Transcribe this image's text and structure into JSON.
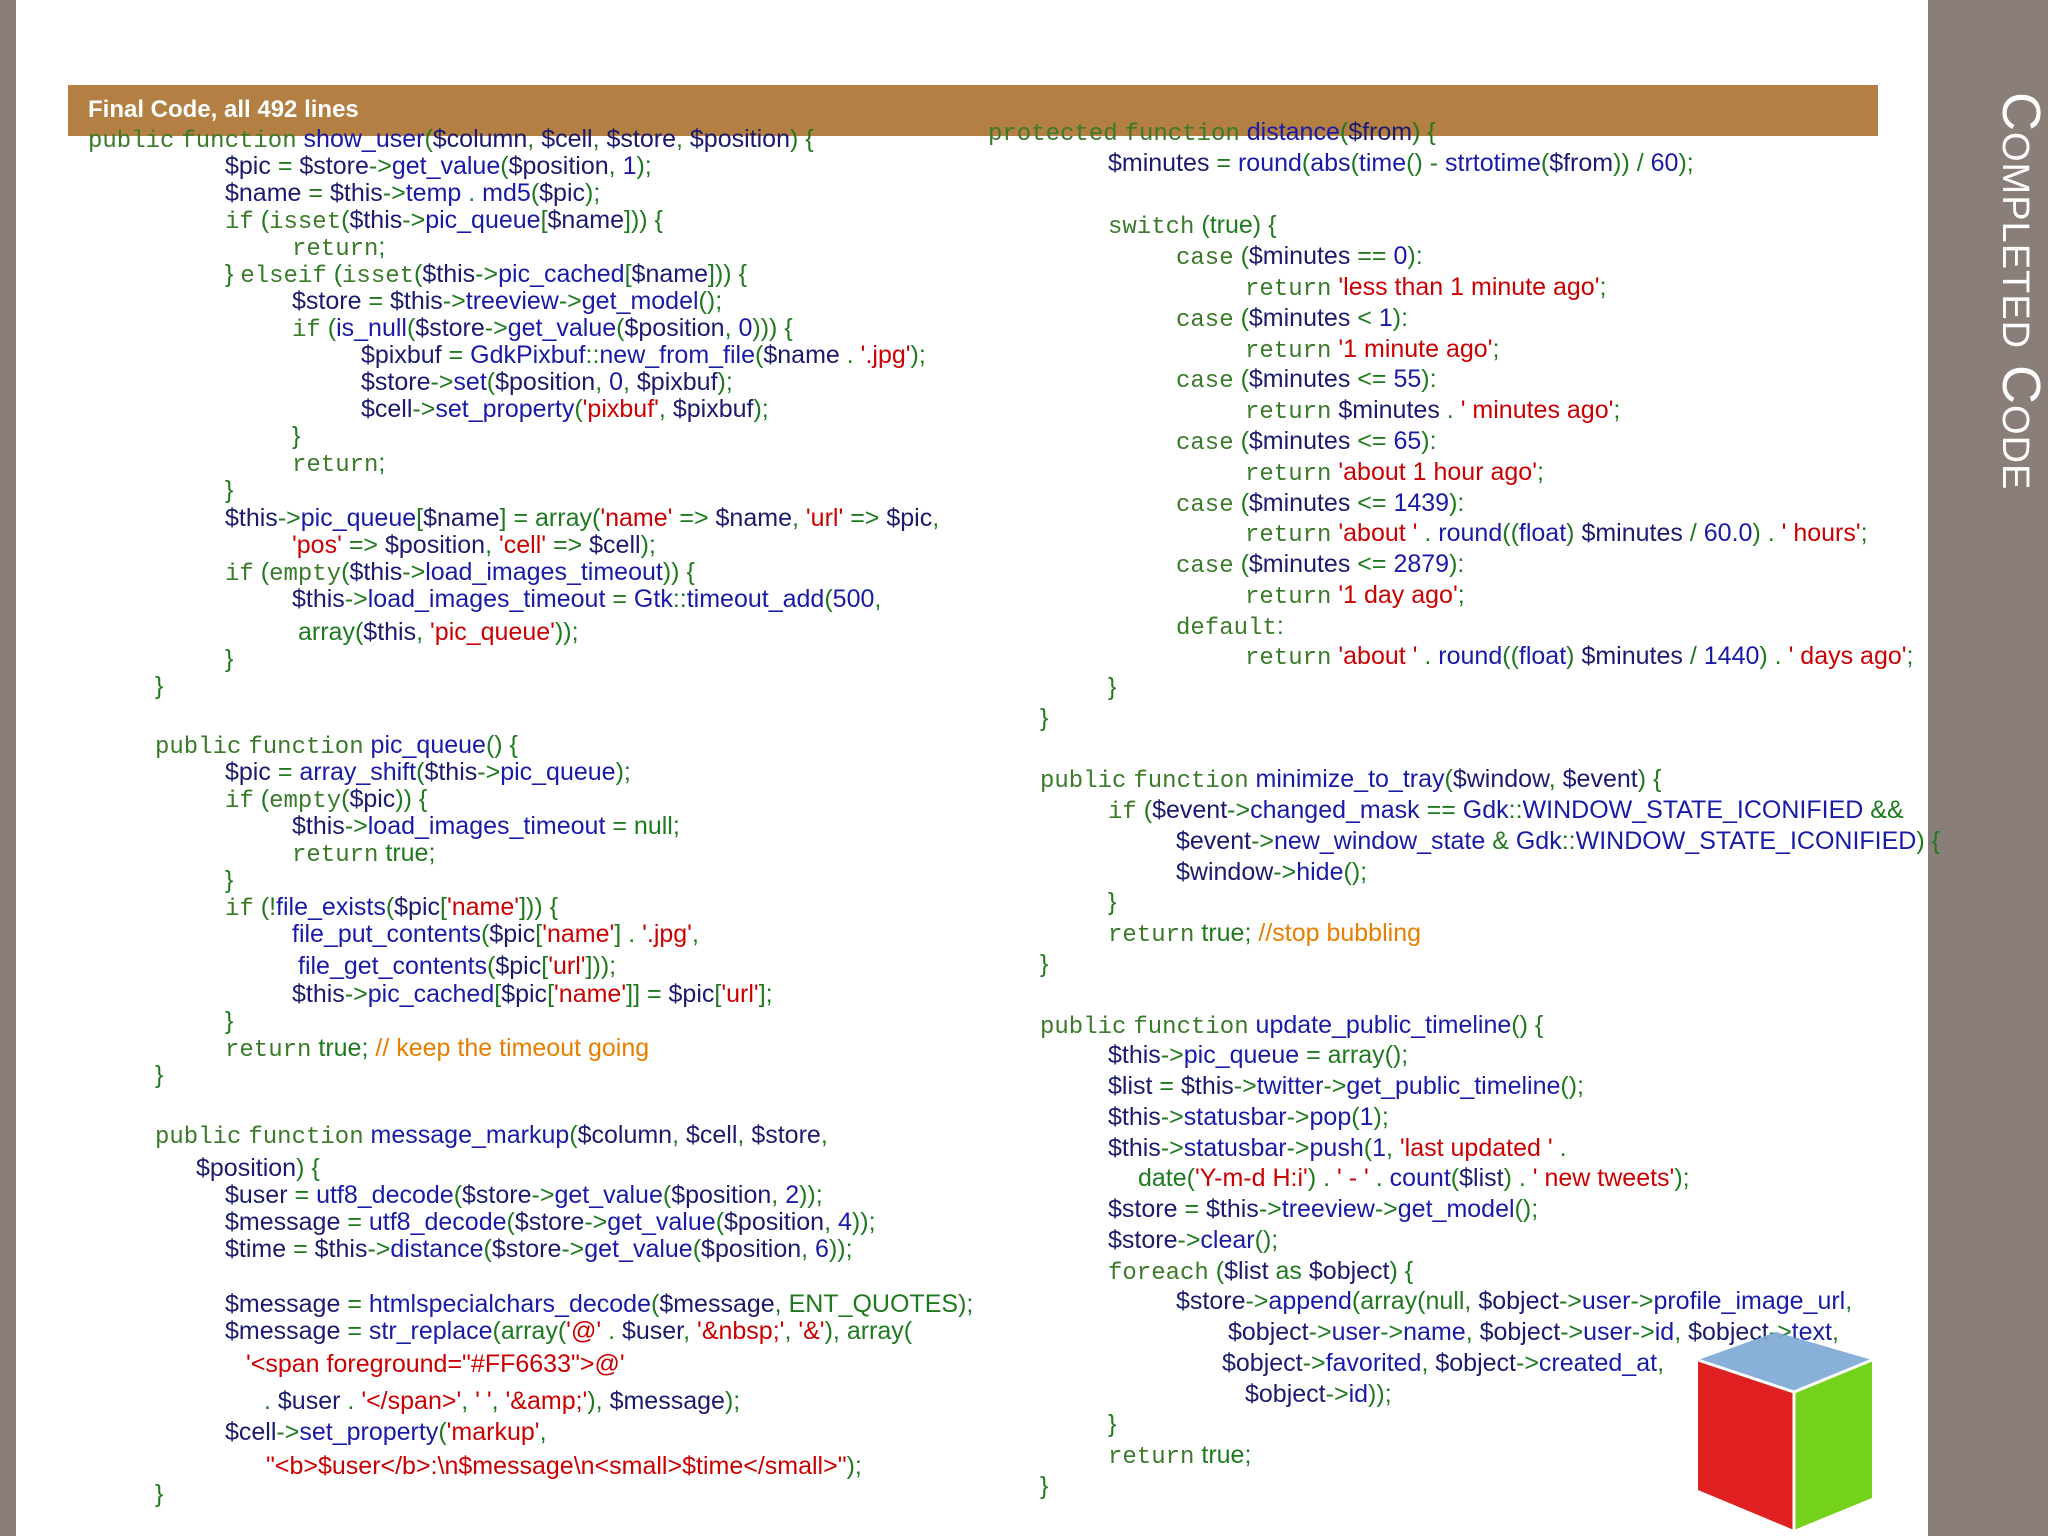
{
  "slide": {
    "header": "Final Code, all 492 lines",
    "title": "Completed Code"
  },
  "code": {
    "left": [
      "public function show_user($column, $cell, $store, $position) {",
      "$pic = $store->get_value($position, 1);",
      "$name = $this->temp . md5($pic);",
      "if (isset($this->pic_queue[$name])) {",
      "return;",
      "} elseif (isset($this->pic_cached[$name])) {",
      "$store = $this->treeview->get_model();",
      "if (is_null($store->get_value($position, 0))) {",
      "$pixbuf = GdkPixbuf::new_from_file($name . '.jpg');",
      "$store->set($position, 0, $pixbuf);",
      "$cell->set_property('pixbuf', $pixbuf);",
      "}",
      "return;",
      "}",
      "$this->pic_queue[$name] = array('name' => $name, 'url' => $pic,",
      "'pos' => $position, 'cell' => $cell);",
      "if (empty($this->load_images_timeout)) {",
      "$this->load_images_timeout = Gtk::timeout_add(500,",
      "array($this, 'pic_queue'));",
      "}",
      "}",
      "public function pic_queue() {",
      "$pic = array_shift($this->pic_queue);",
      "if (empty($pic)) {",
      "$this->load_images_timeout = null;",
      "return true;",
      "}",
      "if (!file_exists($pic['name'])) {",
      "file_put_contents($pic['name'] . '.jpg',",
      "file_get_contents($pic['url']));",
      "$this->pic_cached[$pic['name']] = $pic['url'];",
      "}",
      "return true; // keep the timeout going",
      "}",
      "public function message_markup($column, $cell, $store,",
      "$position) {",
      "$user = utf8_decode($store->get_value($position, 2));",
      "$message = utf8_decode($store->get_value($position, 4));",
      "$time = $this->distance($store->get_value($position, 6));",
      "$message = htmlspecialchars_decode($message, ENT_QUOTES);",
      "$message = str_replace(array('@' . $user, '&nbsp;', '&'), array(",
      "'<span foreground=\"#FF6633\">@'",
      ". $user . '</span>', ' ', '&amp;'), $message);",
      "$cell->set_property('markup',",
      "\"<b>$user</b>:\\n$message\\n<small>$time</small>\");",
      "}"
    ],
    "right": [
      "protected function distance($from) {",
      "$minutes = round(abs(time() - strtotime($from)) / 60);",
      "switch (true) {",
      "case ($minutes == 0):",
      "return 'less than 1 minute ago';",
      "case ($minutes < 1):",
      "return '1 minute ago';",
      "case ($minutes <= 55):",
      "return $minutes . ' minutes ago';",
      "case ($minutes <= 65):",
      "return 'about 1 hour ago';",
      "case ($minutes <= 1439):",
      "return 'about ' . round((float) $minutes / 60.0) . ' hours';",
      "case ($minutes <= 2879):",
      "return '1 day ago';",
      "default:",
      "return 'about ' . round((float) $minutes / 1440) . ' days ago';",
      "}",
      "}",
      "public function minimize_to_tray($window, $event) {",
      "if ($event->changed_mask == Gdk::WINDOW_STATE_ICONIFIED &&",
      "$event->new_window_state & Gdk::WINDOW_STATE_ICONIFIED) {",
      "$window->hide();",
      "}",
      "return true; //stop bubbling",
      "}",
      "public function update_public_timeline() {",
      "$this->pic_queue = array();",
      "$list = $this->twitter->get_public_timeline();",
      "$this->statusbar->pop(1);",
      "$this->statusbar->push(1, 'last updated ' .",
      "date('Y-m-d H:i') . ' - ' . count($list) . ' new tweets');",
      "$store = $this->treeview->get_model();",
      "$store->clear();",
      "foreach ($list as $object) {",
      "$store->append(array(null, $object->user->profile_image_url,",
      "$object->user->name, $object->user->id, $object->text,",
      "$object->favorited, $object->created_at,",
      "$object->id));",
      "}",
      "return true;",
      "}"
    ]
  }
}
